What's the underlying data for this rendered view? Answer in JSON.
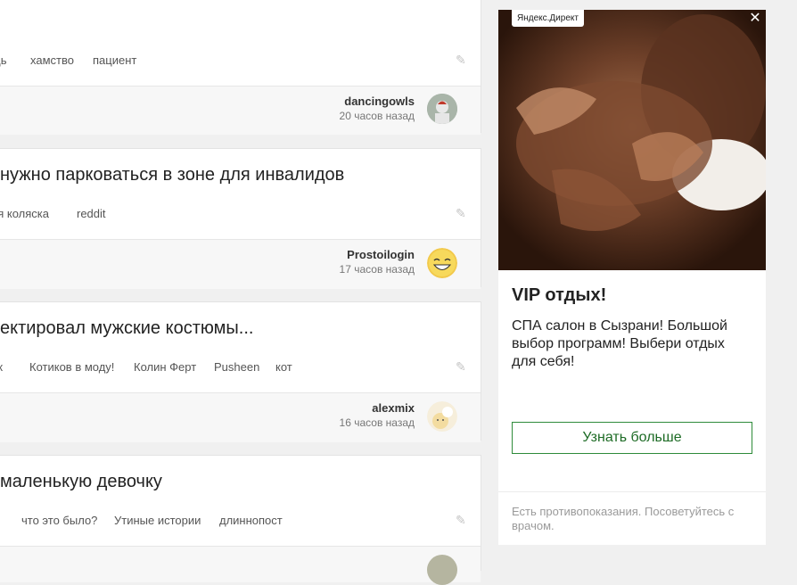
{
  "stories": [
    {
      "title": "",
      "tags": [
        "щь",
        "хамство",
        "пациент"
      ],
      "author": "dancingowls",
      "time": "20 часов назад"
    },
    {
      "title": "нужно парковаться в зоне для инвалидов",
      "tags": [
        "ая коляска",
        "reddit"
      ],
      "author": "Prostoilogin",
      "time": "17 часов назад"
    },
    {
      "title": "ектировал мужские костюмы...",
      "tags": [
        "ик",
        "Котиков в моду!",
        "Колин Ферт",
        "Pusheen",
        "кот"
      ],
      "author": "alexmix",
      "time": "16 часов назад"
    },
    {
      "title": "маленькую девочку",
      "tags": [
        "к",
        "что это было?",
        "Утиные истории",
        "длиннопост"
      ],
      "author": "",
      "time": ""
    }
  ],
  "ad": {
    "badge": "Яндекс.Директ",
    "headline": "VIP отдых!",
    "text": "СПА салон в Сызрани! Большой выбор программ! Выбери отдых для себя!",
    "cta": "Узнать больше",
    "disclaimer": "Есть противопоказания. Посоветуйтесь с врачом."
  }
}
